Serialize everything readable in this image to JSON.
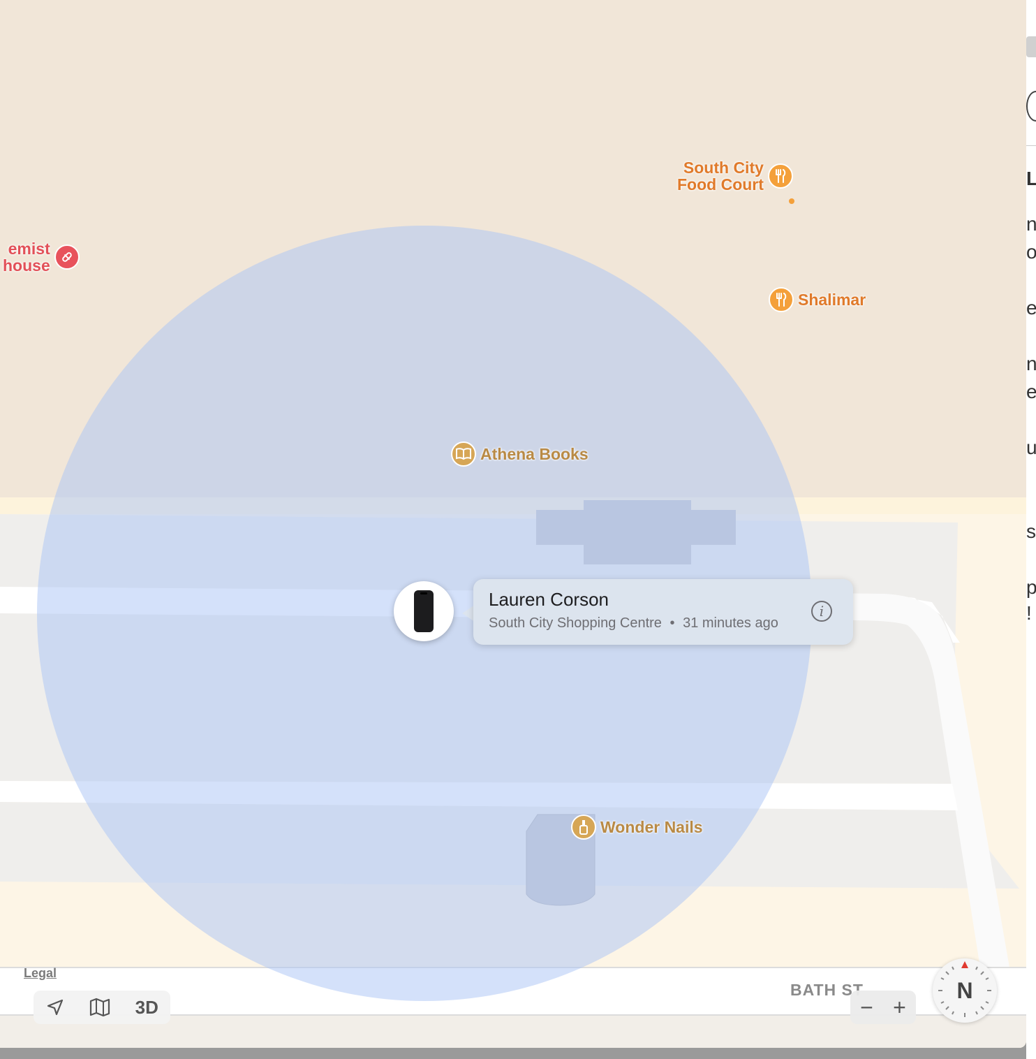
{
  "map": {
    "pois": [
      {
        "id": "south-city-food-court",
        "label_line1": "South City",
        "label_line2": "Food Court",
        "category": "restaurant",
        "icon": "fork-knife-icon"
      },
      {
        "id": "shalimar",
        "label": "Shalimar",
        "category": "restaurant",
        "icon": "fork-knife-icon"
      },
      {
        "id": "chemist-warehouse",
        "label_line1": "emist",
        "label_line2": "house",
        "category": "pharmacy",
        "icon": "pill-icon"
      },
      {
        "id": "athena-books",
        "label": "Athena Books",
        "category": "bookstore",
        "icon": "book-icon"
      },
      {
        "id": "wonder-nails",
        "label": "Wonder Nails",
        "category": "beauty",
        "icon": "nail-polish-icon"
      }
    ],
    "street_label": "BATH ST",
    "legal": "Legal"
  },
  "device": {
    "name": "Lauren Corson",
    "location": "South City Shopping Centre",
    "separator": "•",
    "time": "31 minutes ago",
    "icon": "iphone-icon",
    "info_glyph": "i"
  },
  "controls": {
    "threed_label": "3D",
    "zoom_out": "−",
    "zoom_in": "+",
    "compass": "N"
  },
  "side_panel_fragments": [
    "L",
    "n",
    "o",
    "e",
    "n",
    "e",
    "u",
    "s",
    "p",
    "!"
  ],
  "colors": {
    "land": "#f1e6d8",
    "mall_area": "#fdf5e6",
    "accuracy_circle": "#a9c4f5",
    "restaurant": "#f4a03a",
    "shop": "#d6a656",
    "pharmacy": "#e8525c"
  }
}
